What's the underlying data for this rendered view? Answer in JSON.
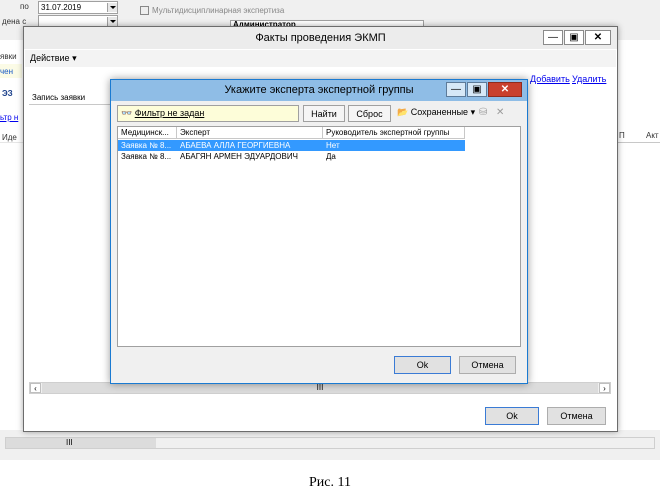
{
  "background": {
    "date_label": "по",
    "date_value": "31.07.2019",
    "created_label": "дена с",
    "checkbox_label": "Мультидисциплинарная экспертиза",
    "admin_text": "Администратор",
    "left_labels": [
      "явки",
      "чен",
      "ЭЗ",
      "ьтр н",
      "Иде"
    ],
    "right_col_labels": [
      "П",
      "Акт"
    ]
  },
  "main_window": {
    "title": "Факты проведения ЭКМП",
    "menu_action": "Действие",
    "link_add": "Добавить",
    "link_delete": "Удалить",
    "column_request": "Запись заявки",
    "scroll_mid": "III",
    "ok_label": "Ok",
    "cancel_label": "Отмена"
  },
  "dialog": {
    "title": "Укажите эксперта экспертной группы",
    "filter_text": "Фильтр не задан",
    "find_label": "Найти",
    "reset_label": "Сброс",
    "saved_label": "Сохраненные",
    "columns": [
      "Медицинск...",
      "Эксперт",
      "Руководитель экспертной группы"
    ],
    "rows": [
      {
        "col1": "Заявка № 8...",
        "col2": "АБАЕВА АЛЛА ГЕОРГИЕВНА",
        "col3": "Нет",
        "selected": true
      },
      {
        "col1": "Заявка № 8...",
        "col2": "АБАГЯН АРМЕН ЭДУАРДОВИЧ",
        "col3": "Да",
        "selected": false
      }
    ],
    "ok_label": "Ok",
    "cancel_label": "Отмена"
  },
  "bottom": {
    "scroll_mid": "III"
  },
  "caption": "Рис. 11",
  "colors": {
    "dialog_title_bg": "#8fbde6",
    "selection": "#3399ff",
    "close_red": "#c9402d",
    "filter_bg": "#fdfdd9",
    "link": "#0000ee"
  }
}
